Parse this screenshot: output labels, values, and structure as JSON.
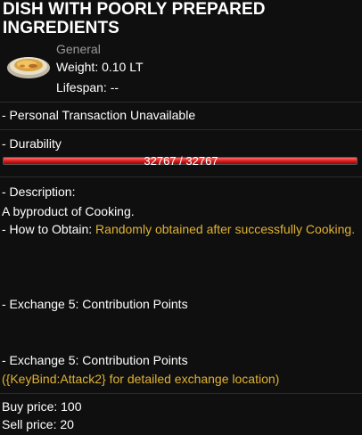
{
  "item": {
    "title": "DISH WITH POORLY PREPARED INGREDIENTS",
    "icon": "food-dish-icon",
    "category": "General",
    "weight": "Weight: 0.10 LT",
    "lifespan": "Lifespan: --"
  },
  "personal_transaction": "- Personal Transaction Unavailable",
  "durability": {
    "label": "- Durability",
    "current": 32767,
    "max": 32767,
    "text": "32767 / 32767",
    "fill_fraction": 1.0
  },
  "description": {
    "header": "- Description:",
    "text": "A byproduct of Cooking.",
    "how_to_obtain_label": "- How to Obtain: ",
    "how_to_obtain_text": "Randomly obtained after successfully Cooking."
  },
  "exchange_1": "- Exchange 5: Contribution Points",
  "exchange_2": "- Exchange 5: Contribution Points",
  "exchange_hint": "({KeyBind:Attack2} for detailed exchange location)",
  "prices": {
    "buy": "Buy price: 100",
    "sell": "Sell price: 20"
  },
  "colors": {
    "highlight": "#e0b233",
    "bar": "#d41b1b"
  }
}
